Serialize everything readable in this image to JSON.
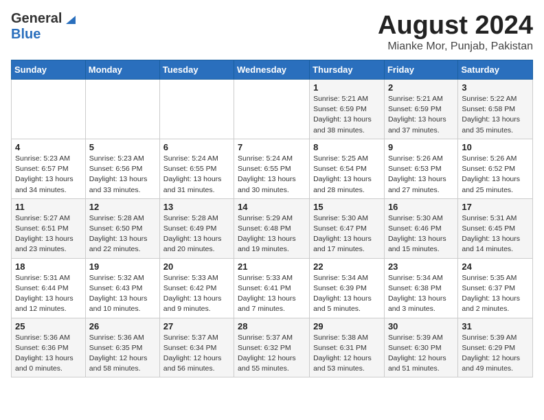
{
  "header": {
    "logo_general": "General",
    "logo_blue": "Blue",
    "month_title": "August 2024",
    "location": "Mianke Mor, Punjab, Pakistan"
  },
  "weekdays": [
    "Sunday",
    "Monday",
    "Tuesday",
    "Wednesday",
    "Thursday",
    "Friday",
    "Saturday"
  ],
  "weeks": [
    [
      {
        "day": "",
        "info": ""
      },
      {
        "day": "",
        "info": ""
      },
      {
        "day": "",
        "info": ""
      },
      {
        "day": "",
        "info": ""
      },
      {
        "day": "1",
        "info": "Sunrise: 5:21 AM\nSunset: 6:59 PM\nDaylight: 13 hours\nand 38 minutes."
      },
      {
        "day": "2",
        "info": "Sunrise: 5:21 AM\nSunset: 6:59 PM\nDaylight: 13 hours\nand 37 minutes."
      },
      {
        "day": "3",
        "info": "Sunrise: 5:22 AM\nSunset: 6:58 PM\nDaylight: 13 hours\nand 35 minutes."
      }
    ],
    [
      {
        "day": "4",
        "info": "Sunrise: 5:23 AM\nSunset: 6:57 PM\nDaylight: 13 hours\nand 34 minutes."
      },
      {
        "day": "5",
        "info": "Sunrise: 5:23 AM\nSunset: 6:56 PM\nDaylight: 13 hours\nand 33 minutes."
      },
      {
        "day": "6",
        "info": "Sunrise: 5:24 AM\nSunset: 6:55 PM\nDaylight: 13 hours\nand 31 minutes."
      },
      {
        "day": "7",
        "info": "Sunrise: 5:24 AM\nSunset: 6:55 PM\nDaylight: 13 hours\nand 30 minutes."
      },
      {
        "day": "8",
        "info": "Sunrise: 5:25 AM\nSunset: 6:54 PM\nDaylight: 13 hours\nand 28 minutes."
      },
      {
        "day": "9",
        "info": "Sunrise: 5:26 AM\nSunset: 6:53 PM\nDaylight: 13 hours\nand 27 minutes."
      },
      {
        "day": "10",
        "info": "Sunrise: 5:26 AM\nSunset: 6:52 PM\nDaylight: 13 hours\nand 25 minutes."
      }
    ],
    [
      {
        "day": "11",
        "info": "Sunrise: 5:27 AM\nSunset: 6:51 PM\nDaylight: 13 hours\nand 23 minutes."
      },
      {
        "day": "12",
        "info": "Sunrise: 5:28 AM\nSunset: 6:50 PM\nDaylight: 13 hours\nand 22 minutes."
      },
      {
        "day": "13",
        "info": "Sunrise: 5:28 AM\nSunset: 6:49 PM\nDaylight: 13 hours\nand 20 minutes."
      },
      {
        "day": "14",
        "info": "Sunrise: 5:29 AM\nSunset: 6:48 PM\nDaylight: 13 hours\nand 19 minutes."
      },
      {
        "day": "15",
        "info": "Sunrise: 5:30 AM\nSunset: 6:47 PM\nDaylight: 13 hours\nand 17 minutes."
      },
      {
        "day": "16",
        "info": "Sunrise: 5:30 AM\nSunset: 6:46 PM\nDaylight: 13 hours\nand 15 minutes."
      },
      {
        "day": "17",
        "info": "Sunrise: 5:31 AM\nSunset: 6:45 PM\nDaylight: 13 hours\nand 14 minutes."
      }
    ],
    [
      {
        "day": "18",
        "info": "Sunrise: 5:31 AM\nSunset: 6:44 PM\nDaylight: 13 hours\nand 12 minutes."
      },
      {
        "day": "19",
        "info": "Sunrise: 5:32 AM\nSunset: 6:43 PM\nDaylight: 13 hours\nand 10 minutes."
      },
      {
        "day": "20",
        "info": "Sunrise: 5:33 AM\nSunset: 6:42 PM\nDaylight: 13 hours\nand 9 minutes."
      },
      {
        "day": "21",
        "info": "Sunrise: 5:33 AM\nSunset: 6:41 PM\nDaylight: 13 hours\nand 7 minutes."
      },
      {
        "day": "22",
        "info": "Sunrise: 5:34 AM\nSunset: 6:39 PM\nDaylight: 13 hours\nand 5 minutes."
      },
      {
        "day": "23",
        "info": "Sunrise: 5:34 AM\nSunset: 6:38 PM\nDaylight: 13 hours\nand 3 minutes."
      },
      {
        "day": "24",
        "info": "Sunrise: 5:35 AM\nSunset: 6:37 PM\nDaylight: 13 hours\nand 2 minutes."
      }
    ],
    [
      {
        "day": "25",
        "info": "Sunrise: 5:36 AM\nSunset: 6:36 PM\nDaylight: 13 hours\nand 0 minutes."
      },
      {
        "day": "26",
        "info": "Sunrise: 5:36 AM\nSunset: 6:35 PM\nDaylight: 12 hours\nand 58 minutes."
      },
      {
        "day": "27",
        "info": "Sunrise: 5:37 AM\nSunset: 6:34 PM\nDaylight: 12 hours\nand 56 minutes."
      },
      {
        "day": "28",
        "info": "Sunrise: 5:37 AM\nSunset: 6:32 PM\nDaylight: 12 hours\nand 55 minutes."
      },
      {
        "day": "29",
        "info": "Sunrise: 5:38 AM\nSunset: 6:31 PM\nDaylight: 12 hours\nand 53 minutes."
      },
      {
        "day": "30",
        "info": "Sunrise: 5:39 AM\nSunset: 6:30 PM\nDaylight: 12 hours\nand 51 minutes."
      },
      {
        "day": "31",
        "info": "Sunrise: 5:39 AM\nSunset: 6:29 PM\nDaylight: 12 hours\nand 49 minutes."
      }
    ]
  ]
}
